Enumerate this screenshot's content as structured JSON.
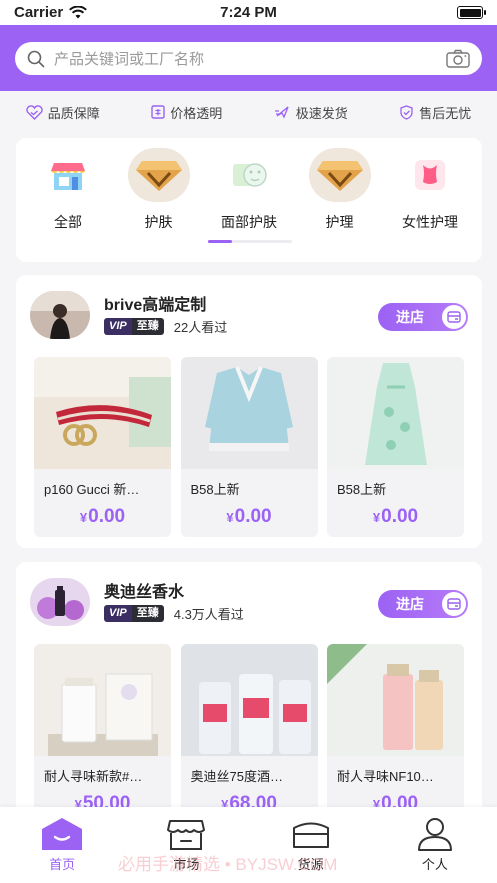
{
  "status_bar": {
    "carrier": "Carrier",
    "time": "7:24 PM"
  },
  "search": {
    "placeholder": "产品关键词或工厂名称"
  },
  "badges": [
    "品质保障",
    "价格透明",
    "极速发货",
    "售后无忧"
  ],
  "categories": [
    "全部",
    "护肤",
    "面部护肤",
    "护理",
    "女性护理"
  ],
  "shops": [
    {
      "name": "brive高端定制",
      "vip_a": "VIP",
      "vip_b": "至臻",
      "views": "22人看过",
      "enter_label": "进店",
      "products": [
        {
          "title": "p160 Gucci 新…",
          "currency": "¥",
          "price": "0.00"
        },
        {
          "title": "B58上新",
          "currency": "¥",
          "price": "0.00"
        },
        {
          "title": "B58上新",
          "currency": "¥",
          "price": "0.00"
        }
      ]
    },
    {
      "name": "奥迪丝香水",
      "vip_a": "VIP",
      "vip_b": "至臻",
      "views": "4.3万人看过",
      "enter_label": "进店",
      "products": [
        {
          "title": "耐人寻味新款#…",
          "currency": "¥",
          "price": "50.00"
        },
        {
          "title": "奥迪丝75度酒…",
          "currency": "¥",
          "price": "68.00"
        },
        {
          "title": "耐人寻味NF10…",
          "currency": "¥",
          "price": "0.00"
        }
      ]
    }
  ],
  "tabbar": [
    "首页",
    "市场",
    "货源",
    "个人"
  ],
  "watermark": "必用手游精选 • BYJSW.COM",
  "colors": {
    "accent": "#9b62f4"
  }
}
